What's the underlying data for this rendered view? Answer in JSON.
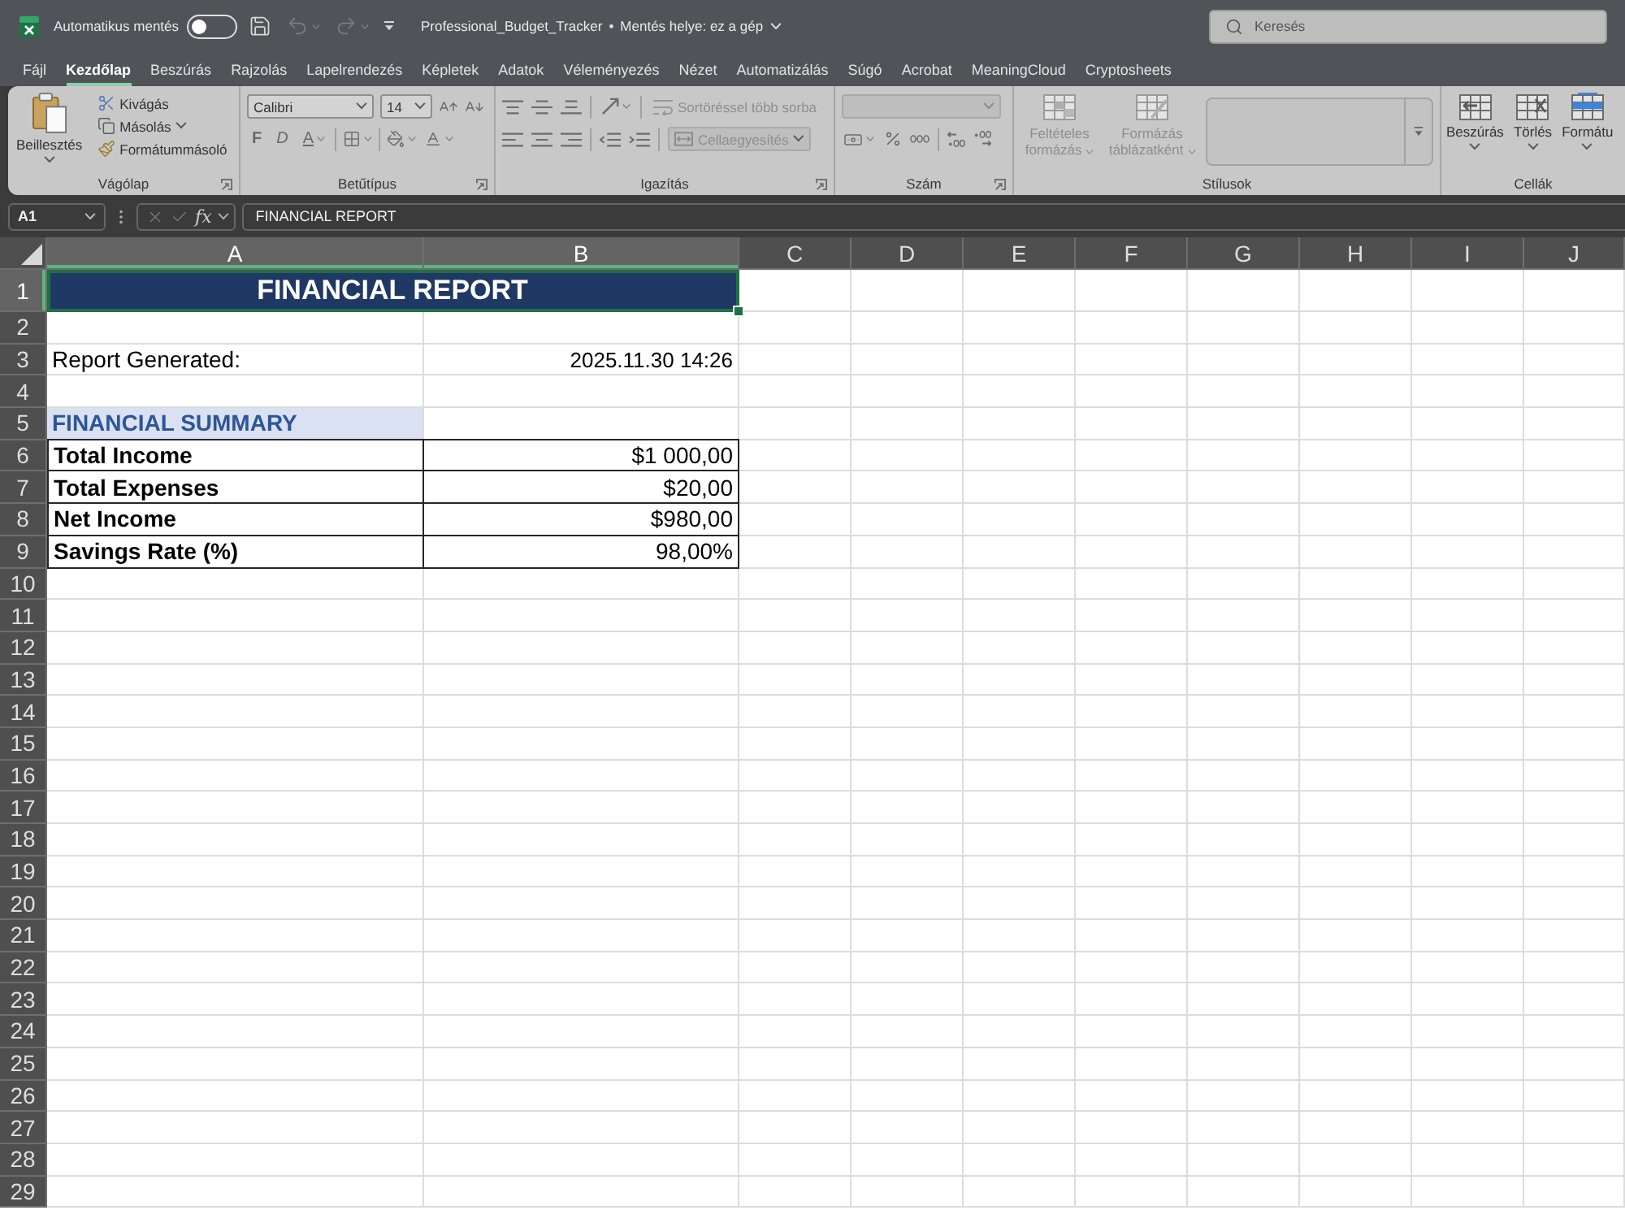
{
  "title_bar": {
    "autosave_label": "Automatikus mentés",
    "autosave_on": false,
    "quick_access": [
      {
        "kind": "save",
        "disabled": false
      },
      {
        "kind": "undo",
        "disabled": true
      },
      {
        "kind": "redo",
        "disabled": true
      },
      {
        "kind": "customize",
        "disabled": false
      }
    ],
    "document": "Professional_Budget_Tracker",
    "separator": "•",
    "location": "Mentés helye: ez a gép",
    "search_placeholder": "Keresés"
  },
  "menu_tabs": [
    {
      "label": "Fájl",
      "selected": false
    },
    {
      "label": "Kezdőlap",
      "selected": true
    },
    {
      "label": "Beszúrás",
      "selected": false
    },
    {
      "label": "Rajzolás",
      "selected": false
    },
    {
      "label": "Lapelrendezés",
      "selected": false
    },
    {
      "label": "Képletek",
      "selected": false
    },
    {
      "label": "Adatok",
      "selected": false
    },
    {
      "label": "Véleményezés",
      "selected": false
    },
    {
      "label": "Nézet",
      "selected": false
    },
    {
      "label": "Automatizálás",
      "selected": false
    },
    {
      "label": "Súgó",
      "selected": false
    },
    {
      "label": "Acrobat",
      "selected": false
    },
    {
      "label": "MeaningCloud",
      "selected": false
    },
    {
      "label": "Cryptosheets",
      "selected": false
    }
  ],
  "ribbon": {
    "clipboard": {
      "title": "Vágólap",
      "paste": "Beillesztés",
      "items": [
        {
          "kind": "cut",
          "label": "Kivágás"
        },
        {
          "kind": "copy",
          "label": "Másolás"
        },
        {
          "kind": "painter",
          "label": "Formátummásoló"
        }
      ]
    },
    "font": {
      "title": "Betűtípus",
      "font_name": "Calibri",
      "font_size": "14",
      "styles": [
        {
          "kind": "bold",
          "label": "F"
        },
        {
          "kind": "italic",
          "label": "D"
        },
        {
          "kind": "underline",
          "label": "A"
        }
      ]
    },
    "alignment": {
      "title": "Igazítás",
      "wrap_text": {
        "label": "Sortöréssel több sorba",
        "disabled": true
      },
      "merge": {
        "label": "Cellaegyesítés",
        "disabled": true
      }
    },
    "number": {
      "title": "Szám",
      "format_box": {
        "disabled": true
      }
    },
    "styles": {
      "title": "Stílusok",
      "items": [
        {
          "kind": "conditional",
          "label": "Feltételes formázás",
          "disabled": true
        },
        {
          "kind": "table",
          "label": "Formázás táblázatként",
          "disabled": true
        }
      ]
    },
    "cells": {
      "title": "Cellák",
      "items": [
        {
          "kind": "insert",
          "label": "Beszúrás"
        },
        {
          "kind": "delete",
          "label": "Törlés"
        },
        {
          "kind": "format",
          "label": "Formátu"
        }
      ]
    }
  },
  "formula_bar": {
    "name_box": "A1",
    "function_symbol": "fx",
    "formula": "FINANCIAL REPORT"
  },
  "sheet": {
    "columns": [
      {
        "label": "A",
        "selected": true
      },
      {
        "label": "B",
        "selected": true
      },
      {
        "label": "C",
        "selected": false
      },
      {
        "label": "D",
        "selected": false
      },
      {
        "label": "E",
        "selected": false
      },
      {
        "label": "F",
        "selected": false
      },
      {
        "label": "G",
        "selected": false
      },
      {
        "label": "H",
        "selected": false
      },
      {
        "label": "I",
        "selected": false
      },
      {
        "label": "J",
        "selected": false
      }
    ],
    "rows": [
      {
        "number": "1",
        "selected": true,
        "cells": [
          {
            "kind": "title",
            "text": "FINANCIAL REPORT",
            "selected": true
          }
        ]
      },
      {
        "number": "2",
        "selected": false
      },
      {
        "number": "3",
        "selected": false,
        "cells": [
          {
            "kind": "label",
            "text": "Report Generated:",
            "selected": false
          },
          {
            "kind": "value",
            "text": "2025.11.30 14:26",
            "selected": false
          }
        ]
      },
      {
        "number": "4",
        "selected": false
      },
      {
        "number": "5",
        "selected": false,
        "cells": [
          {
            "kind": "section",
            "text": "FINANCIAL SUMMARY",
            "selected": false
          }
        ]
      },
      {
        "number": "6",
        "selected": false,
        "cells": [
          {
            "kind": "table_label",
            "text": "Total Income",
            "selected": false
          },
          {
            "kind": "table_value",
            "text": "$1 000,00",
            "selected": false
          }
        ]
      },
      {
        "number": "7",
        "selected": false,
        "cells": [
          {
            "kind": "table_label",
            "text": "Total Expenses",
            "selected": false
          },
          {
            "kind": "table_value",
            "text": "$20,00",
            "selected": false
          }
        ]
      },
      {
        "number": "8",
        "selected": false,
        "cells": [
          {
            "kind": "table_label",
            "text": "Net Income",
            "selected": false
          },
          {
            "kind": "table_value",
            "text": "$980,00",
            "selected": false
          }
        ]
      },
      {
        "number": "9",
        "selected": false,
        "cells": [
          {
            "kind": "table_label",
            "text": "Savings Rate (%)",
            "selected": false
          },
          {
            "kind": "table_value",
            "text": "98,00%",
            "selected": false
          }
        ]
      },
      {
        "number": "10",
        "selected": false
      },
      {
        "number": "11",
        "selected": false
      },
      {
        "number": "12",
        "selected": false
      },
      {
        "number": "13",
        "selected": false
      },
      {
        "number": "14",
        "selected": false
      },
      {
        "number": "15",
        "selected": false
      },
      {
        "number": "16",
        "selected": false
      },
      {
        "number": "17",
        "selected": false
      },
      {
        "number": "18",
        "selected": false
      },
      {
        "number": "19",
        "selected": false
      },
      {
        "number": "20",
        "selected": false
      },
      {
        "number": "21",
        "selected": false
      },
      {
        "number": "22",
        "selected": false
      },
      {
        "number": "23",
        "selected": false
      },
      {
        "number": "24",
        "selected": false
      },
      {
        "number": "25",
        "selected": false
      },
      {
        "number": "26",
        "selected": false
      },
      {
        "number": "27",
        "selected": false
      },
      {
        "number": "28",
        "selected": false
      },
      {
        "number": "29",
        "selected": false
      }
    ]
  }
}
